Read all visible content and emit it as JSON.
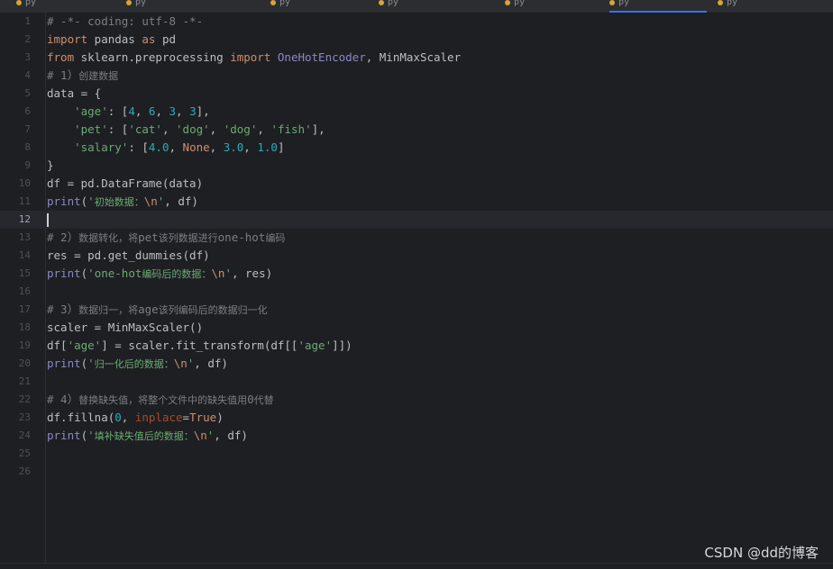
{
  "tabs": [
    {
      "label": "py",
      "active": false
    },
    {
      "label": "py",
      "active": false
    },
    {
      "label": "py",
      "active": false
    },
    {
      "label": "py",
      "active": false
    },
    {
      "label": "py",
      "active": false
    },
    {
      "label": "py",
      "active": true
    },
    {
      "label": "py",
      "active": false
    }
  ],
  "lines": [
    {
      "n": "1",
      "tokens": [
        [
          "cmt",
          "# -*- coding: utf-8 -*-"
        ]
      ]
    },
    {
      "n": "2",
      "tokens": [
        [
          "kw",
          "import"
        ],
        [
          "",
          " pandas "
        ],
        [
          "kw",
          "as"
        ],
        [
          "",
          " pd"
        ]
      ]
    },
    {
      "n": "3",
      "tokens": [
        [
          "kw",
          "from"
        ],
        [
          "",
          " sklearn.preprocessing "
        ],
        [
          "kw",
          "import"
        ],
        [
          "",
          " "
        ],
        [
          "fn",
          "OneHotEncoder"
        ],
        [
          "",
          ", MinMaxScaler"
        ]
      ]
    },
    {
      "n": "4",
      "tokens": [
        [
          "cmt",
          "# 1）"
        ],
        [
          "cmt cjk",
          "创建数据"
        ]
      ]
    },
    {
      "n": "5",
      "tokens": [
        [
          "",
          "data = {"
        ]
      ]
    },
    {
      "n": "6",
      "tokens": [
        [
          "",
          "    "
        ],
        [
          "str",
          "'age'"
        ],
        [
          "",
          ": ["
        ],
        [
          "num",
          "4"
        ],
        [
          "",
          ", "
        ],
        [
          "num",
          "6"
        ],
        [
          "",
          ", "
        ],
        [
          "num",
          "3"
        ],
        [
          "",
          ", "
        ],
        [
          "num",
          "3"
        ],
        [
          "",
          "],"
        ]
      ]
    },
    {
      "n": "7",
      "tokens": [
        [
          "",
          "    "
        ],
        [
          "str",
          "'pet'"
        ],
        [
          "",
          ": ["
        ],
        [
          "str",
          "'cat'"
        ],
        [
          "",
          ", "
        ],
        [
          "str",
          "'dog'"
        ],
        [
          "",
          ", "
        ],
        [
          "str",
          "'dog'"
        ],
        [
          "",
          ", "
        ],
        [
          "str",
          "'fish'"
        ],
        [
          "",
          "],"
        ]
      ]
    },
    {
      "n": "8",
      "tokens": [
        [
          "",
          "    "
        ],
        [
          "str",
          "'salary'"
        ],
        [
          "",
          ": ["
        ],
        [
          "num",
          "4.0"
        ],
        [
          "",
          ", "
        ],
        [
          "kw",
          "None"
        ],
        [
          "",
          ", "
        ],
        [
          "num",
          "3.0"
        ],
        [
          "",
          ", "
        ],
        [
          "num",
          "1.0"
        ],
        [
          "",
          "]"
        ]
      ]
    },
    {
      "n": "9",
      "tokens": [
        [
          "",
          "}"
        ]
      ]
    },
    {
      "n": "10",
      "tokens": [
        [
          "",
          "df = pd.DataFrame(data)"
        ]
      ]
    },
    {
      "n": "11",
      "tokens": [
        [
          "fn",
          "print"
        ],
        [
          "",
          "("
        ],
        [
          "str",
          "'"
        ],
        [
          "str cjk",
          "初始数据："
        ],
        [
          "esc",
          "\\n"
        ],
        [
          "str",
          "'"
        ],
        [
          "",
          ", df)"
        ]
      ]
    },
    {
      "n": "12",
      "tokens": [],
      "current": true
    },
    {
      "n": "13",
      "tokens": [
        [
          "cmt",
          "# 2）"
        ],
        [
          "cmt cjk",
          "数据转化，将"
        ],
        [
          "cmt",
          "pet"
        ],
        [
          "cmt cjk",
          "该列数据进行"
        ],
        [
          "cmt",
          "one-hot"
        ],
        [
          "cmt cjk",
          "编码"
        ]
      ]
    },
    {
      "n": "14",
      "tokens": [
        [
          "",
          "res = pd.get_dummies(df)"
        ]
      ]
    },
    {
      "n": "15",
      "tokens": [
        [
          "fn",
          "print"
        ],
        [
          "",
          "("
        ],
        [
          "str",
          "'one-hot"
        ],
        [
          "str cjk",
          "编码后的数据："
        ],
        [
          "esc",
          "\\n"
        ],
        [
          "str",
          "'"
        ],
        [
          "",
          ", res)"
        ]
      ]
    },
    {
      "n": "16",
      "tokens": []
    },
    {
      "n": "17",
      "tokens": [
        [
          "cmt",
          "# 3）"
        ],
        [
          "cmt cjk",
          "数据归一，将"
        ],
        [
          "cmt",
          "age"
        ],
        [
          "cmt cjk",
          "该列编码后的数据归一化"
        ]
      ]
    },
    {
      "n": "18",
      "tokens": [
        [
          "",
          "scaler = MinMaxScaler()"
        ]
      ]
    },
    {
      "n": "19",
      "tokens": [
        [
          "",
          "df["
        ],
        [
          "str",
          "'age'"
        ],
        [
          "",
          "] = scaler.fit_transform(df[["
        ],
        [
          "str",
          "'age'"
        ],
        [
          "",
          "]])"
        ]
      ]
    },
    {
      "n": "20",
      "tokens": [
        [
          "fn",
          "print"
        ],
        [
          "",
          "("
        ],
        [
          "str",
          "'"
        ],
        [
          "str cjk",
          "归一化后的数据："
        ],
        [
          "esc",
          "\\n"
        ],
        [
          "str",
          "'"
        ],
        [
          "",
          ", df)"
        ]
      ]
    },
    {
      "n": "21",
      "tokens": []
    },
    {
      "n": "22",
      "tokens": [
        [
          "cmt",
          "# 4）"
        ],
        [
          "cmt cjk",
          "替换缺失值，将整个文件中的缺失值用"
        ],
        [
          "cmt",
          "0"
        ],
        [
          "cmt cjk",
          "代替"
        ]
      ]
    },
    {
      "n": "23",
      "tokens": [
        [
          "",
          "df.fillna("
        ],
        [
          "num",
          "0"
        ],
        [
          "",
          ", "
        ],
        [
          "param",
          "inplace"
        ],
        [
          "",
          "="
        ],
        [
          "kw",
          "True"
        ],
        [
          "",
          ")"
        ]
      ]
    },
    {
      "n": "24",
      "tokens": [
        [
          "fn",
          "print"
        ],
        [
          "",
          "("
        ],
        [
          "str",
          "'"
        ],
        [
          "str cjk",
          "填补缺失值后的数据："
        ],
        [
          "esc",
          "\\n"
        ],
        [
          "str",
          "'"
        ],
        [
          "",
          ", df)"
        ]
      ]
    },
    {
      "n": "25",
      "tokens": []
    },
    {
      "n": "26",
      "tokens": []
    }
  ],
  "watermark": "CSDN @dd的博客",
  "colors": {
    "background": "#1e1f22",
    "keyword": "#cf8e6d",
    "string": "#6aab73",
    "number": "#2aacb8",
    "comment": "#7a7e85",
    "builtin": "#8888c6",
    "tab_underline": "#3574f0"
  }
}
